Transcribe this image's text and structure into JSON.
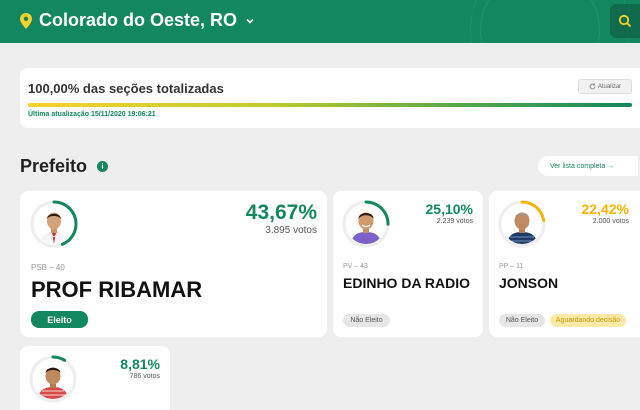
{
  "header": {
    "city": "Colorado do Oeste, RO",
    "icons": {
      "location": "location-pin-icon",
      "dropdown": "chevron-down-icon",
      "search": "search-icon"
    }
  },
  "status": {
    "sections_text": "100,00% das seções totalizadas",
    "progress_percent": 100,
    "update_button": "Atualizar",
    "last_update": "Última atualização 15/11/2020 19:06:21"
  },
  "section": {
    "title": "Prefeito",
    "full_list_link": "Ver lista completa →"
  },
  "colors": {
    "brand": "#13875f",
    "ring_green": "#13875f",
    "ring_yellow": "#f4b400",
    "wait_badge": "#fde9a8"
  },
  "candidates": [
    {
      "name": "PROF RIBAMAR",
      "party": "PSB – 40",
      "percent": "43,67%",
      "votes": "3.895 votos",
      "share": 0.4367,
      "status": "Eleito",
      "status2": ""
    },
    {
      "name": "EDINHO DA RADIO",
      "party": "PV – 43",
      "percent": "25,10%",
      "votes": "2.239 votos",
      "share": 0.251,
      "status": "Não Eleito",
      "status2": ""
    },
    {
      "name": "JONSON",
      "party": "PP – 11",
      "percent": "22,42%",
      "votes": "2.000 votos",
      "share": 0.2242,
      "status": "Não Eleito",
      "status2": "Aguardando decisão"
    },
    {
      "name": "",
      "party": "",
      "percent": "8,81%",
      "votes": "786 votos",
      "share": 0.0881,
      "status": "",
      "status2": ""
    }
  ]
}
